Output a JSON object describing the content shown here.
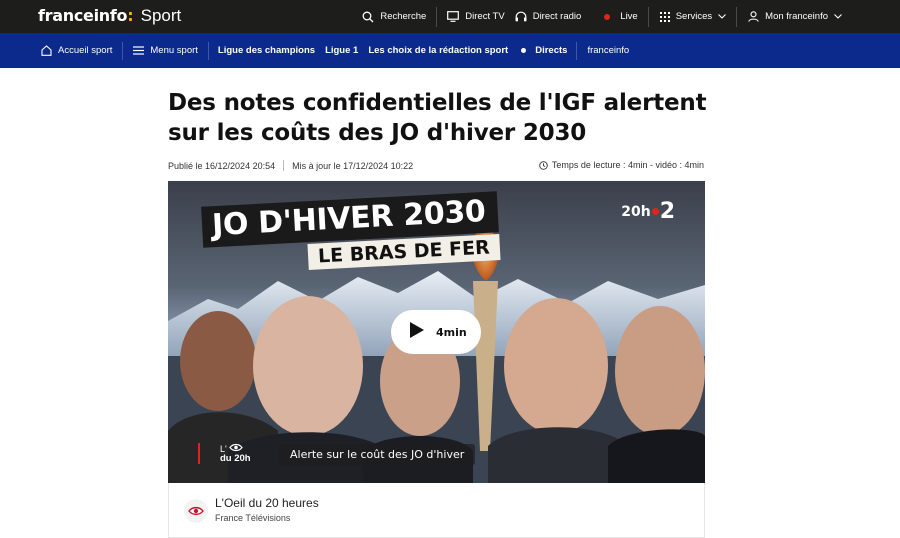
{
  "header": {
    "brand": "franceinfo",
    "brand_colon": ":",
    "section": "Sport",
    "nav": {
      "search": "Recherche",
      "direct_tv": "Direct TV",
      "direct_radio": "Direct radio",
      "live": "Live",
      "services": "Services",
      "account": "Mon franceinfo"
    }
  },
  "sport_nav": {
    "home": "Accueil sport",
    "menu": "Menu sport",
    "items": [
      "Ligue des champions",
      "Ligue 1",
      "Les choix de la rédaction sport"
    ],
    "directs": "Directs",
    "franceinfo": "franceinfo"
  },
  "article": {
    "title": "Des notes confidentielles de l'IGF alertent sur les coûts des JO d'hiver 2030",
    "published": "Publié le 16/12/2024 20:54",
    "updated": "Mis à jour le 17/12/2024 10:22",
    "reading_time": "Temps de lecture : 4min - vidéo : 4min"
  },
  "video": {
    "overlay_title": "JO D'HIVER 2030",
    "overlay_subtitle": "LE BRAS DE FER",
    "channel_logo_left": "20h",
    "channel_logo_right": "2",
    "duration": "4min",
    "program_logo_line1": "L'",
    "program_logo_line2": "du 20h",
    "caption": "Alerte sur le coût des JO d'hiver"
  },
  "source": {
    "name": "L'Oeil du 20 heures",
    "org": "France Télévisions"
  },
  "colors": {
    "topbar": "#1d1d1b",
    "sportbar": "#0b2a8c",
    "accent_yellow": "#f9b000",
    "live_red": "#e2231a"
  }
}
